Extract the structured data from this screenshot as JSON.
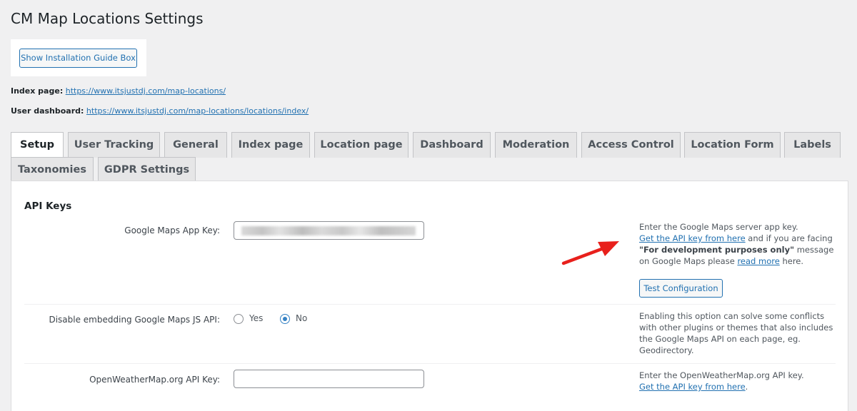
{
  "page": {
    "title": "CM Map Locations Settings"
  },
  "guide_button": "Show Installation Guide Box",
  "index_page": {
    "label": "Index page:",
    "url": "https://www.itsjustdj.com/map-locations/"
  },
  "user_dashboard": {
    "label": "User dashboard:",
    "url": "https://www.itsjustdj.com/map-locations/locations/index/"
  },
  "tabs": [
    {
      "label": "Setup",
      "active": true
    },
    {
      "label": "User Tracking"
    },
    {
      "label": "General"
    },
    {
      "label": "Index page"
    },
    {
      "label": "Location page"
    },
    {
      "label": "Dashboard"
    },
    {
      "label": "Moderation"
    },
    {
      "label": "Access Control"
    },
    {
      "label": "Location Form"
    },
    {
      "label": "Labels"
    },
    {
      "label": "Taxonomies"
    },
    {
      "label": "GDPR Settings"
    }
  ],
  "section": {
    "title": "API Keys"
  },
  "google_key": {
    "label": "Google Maps App Key:",
    "hint_line1": "Enter the Google Maps server app key.",
    "hint_link": "Get the API key from here",
    "hint_after_link": " and if you are facing",
    "hint_bold": "\"For development purposes only\"",
    "hint_after_bold": " message on Google Maps please ",
    "hint_read_more": "read more",
    "hint_end": " here.",
    "test_button": "Test Configuration"
  },
  "disable_js": {
    "label": "Disable embedding Google Maps JS API:",
    "options": [
      {
        "label": "Yes",
        "checked": false
      },
      {
        "label": "No",
        "checked": true
      }
    ],
    "hint": "Enabling this option can solve some conflicts with other plugins or themes that also includes the Google Maps API on each page, eg. Geodirectory."
  },
  "weather": {
    "label": "OpenWeatherMap.org API Key:",
    "value": "",
    "hint_line1": "Enter the OpenWeatherMap.org API key.",
    "hint_link": "Get the API key from here",
    "hint_end": "."
  },
  "colors": {
    "link": "#2271b1",
    "arrow": "#e8201c",
    "radio_checked": "#3582c4"
  }
}
